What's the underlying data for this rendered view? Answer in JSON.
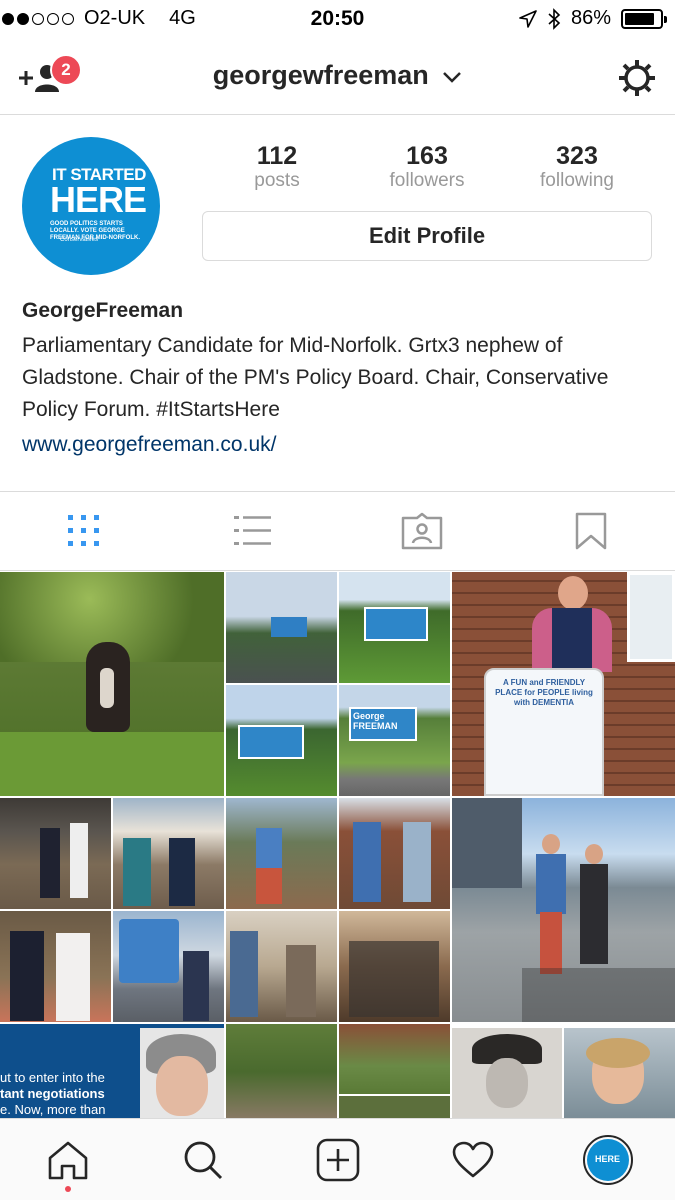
{
  "status_bar": {
    "carrier": "O2-UK",
    "network": "4G",
    "time": "20:50",
    "battery": "86%",
    "battery_level": 0.86,
    "signal_bars_filled": 2,
    "signal_bars_total": 5
  },
  "header": {
    "username": "georgewfreeman",
    "notification_count": "2"
  },
  "avatar": {
    "line1": "IT STARTED",
    "line2": "HERE",
    "line3": "GOOD POLITICS STARTS LOCALLY. VOTE GEORGE FREEMAN FOR MID-NORFOLK.",
    "line4": "Conservatives"
  },
  "stats": [
    {
      "value": "112",
      "label": "posts"
    },
    {
      "value": "163",
      "label": "followers"
    },
    {
      "value": "323",
      "label": "following"
    }
  ],
  "edit_profile_label": "Edit Profile",
  "bio": {
    "name": "GeorgeFreeman",
    "text": "Parliamentary Candidate for Mid-Norfolk. Grtx3 nephew of Gladstone. Chair of the PM's Policy Board. Chair, Conservative Policy Forum. #ItStartsHere",
    "link": "www.georgefreeman.co.uk/"
  },
  "tabs": [
    {
      "icon": "grid-icon",
      "active": true
    },
    {
      "icon": "list-icon",
      "active": false
    },
    {
      "icon": "tagged-icon",
      "active": false
    },
    {
      "icon": "bookmark-icon",
      "active": false
    }
  ],
  "posts": {
    "sign_text": "George FREEMAN",
    "card_text": "A FUN and FRIENDLY PLACE for PEOPLE living with DEMENTIA",
    "speech_line1": "ut to enter into the",
    "speech_line2": "tant negotiations",
    "speech_line3": "e. Now, more than"
  },
  "colors": {
    "accent_blue": "#3897f0",
    "badge_red": "#ed4956",
    "link_blue": "#003569",
    "conservative_blue": "#0e8fd3"
  },
  "bottom_nav": [
    "home-icon",
    "search-icon",
    "new-post-icon",
    "activity-icon",
    "profile-icon"
  ]
}
